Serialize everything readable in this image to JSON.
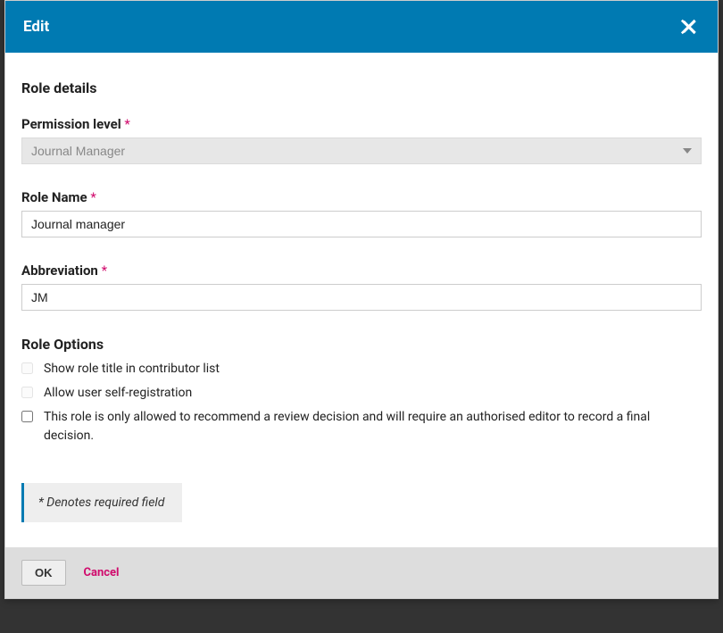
{
  "modal": {
    "title": "Edit"
  },
  "form": {
    "section_title": "Role details",
    "permission_level": {
      "label": "Permission level",
      "value": "Journal Manager"
    },
    "role_name": {
      "label": "Role Name",
      "value": "Journal manager"
    },
    "abbreviation": {
      "label": "Abbreviation",
      "value": "JM"
    },
    "role_options": {
      "title": "Role Options",
      "options": [
        {
          "label": "Show role title in contributor list",
          "checked": false,
          "disabled": true
        },
        {
          "label": "Allow user self-registration",
          "checked": false,
          "disabled": true
        },
        {
          "label": "This role is only allowed to recommend a review decision and will require an authorised editor to record a final decision.",
          "checked": false,
          "disabled": false
        }
      ]
    },
    "required_note": "* Denotes required field"
  },
  "footer": {
    "ok_label": "OK",
    "cancel_label": "Cancel"
  },
  "required_star": "*"
}
